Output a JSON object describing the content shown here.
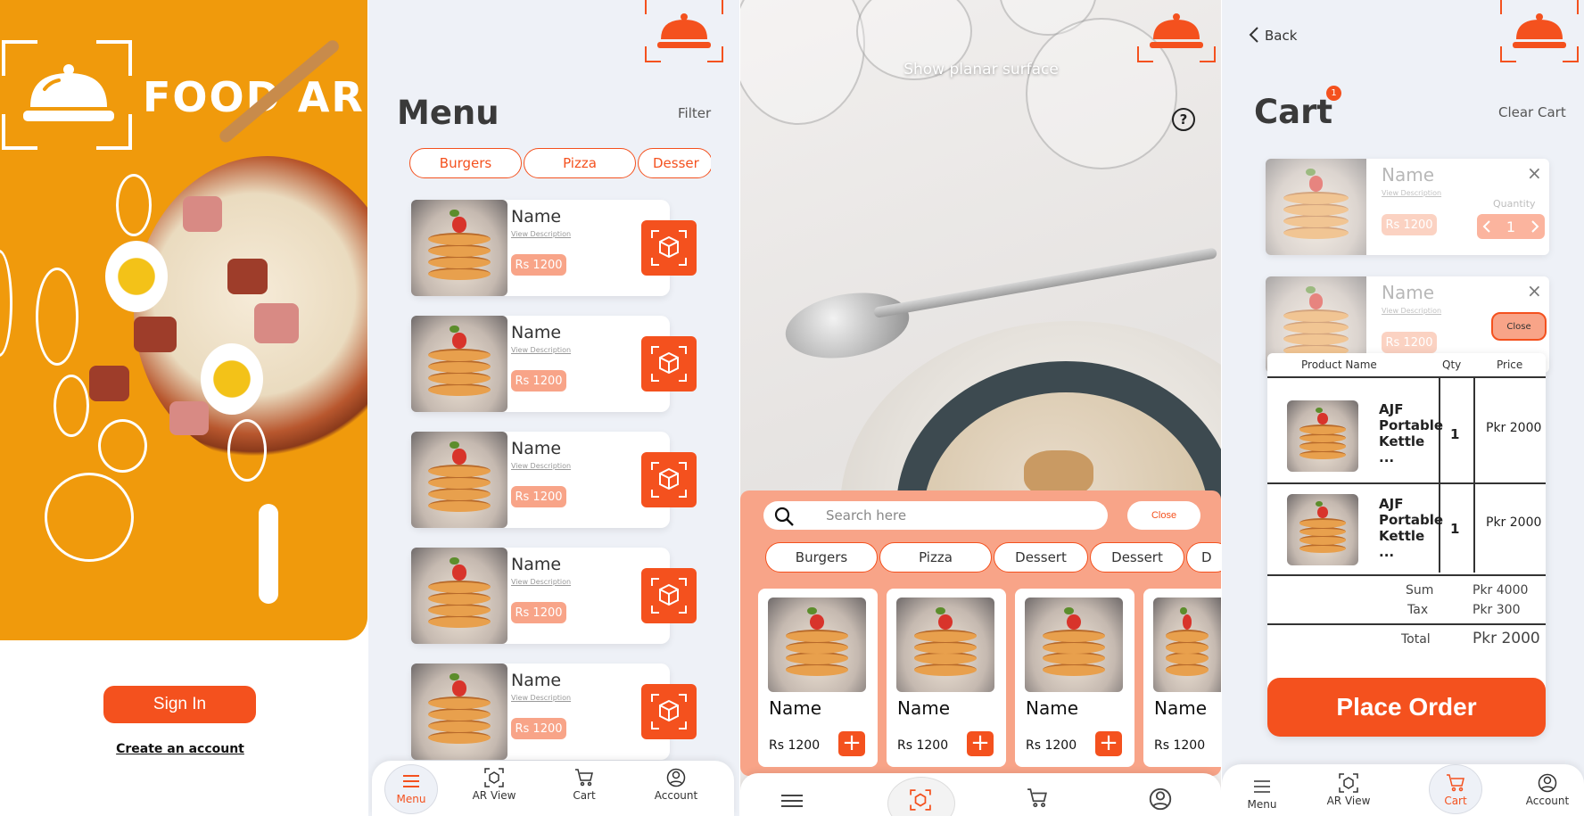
{
  "colors": {
    "brand_orange": "#f09a0c",
    "accent": "#f4511e",
    "accent_light": "#f8a488",
    "bg": "#eef1f7"
  },
  "splash": {
    "brand": "FOOD AR",
    "sign_in": "Sign In",
    "create_account": "Create an account"
  },
  "menu": {
    "title": "Menu",
    "filter": "Filter",
    "categories": [
      "Burgers",
      "Pizza",
      "Desser"
    ],
    "items": [
      {
        "name": "Name",
        "desc": "View Description",
        "price": "Rs 1200"
      },
      {
        "name": "Name",
        "desc": "View Description",
        "price": "Rs 1200"
      },
      {
        "name": "Name",
        "desc": "View Description",
        "price": "Rs 1200"
      },
      {
        "name": "Name",
        "desc": "View Description",
        "price": "Rs 1200"
      },
      {
        "name": "Name",
        "desc": "View Description",
        "price": "Rs 1200"
      }
    ],
    "nav": [
      "Menu",
      "AR View",
      "Cart",
      "Account"
    ]
  },
  "ar": {
    "hint": "Show planar surface",
    "help": "?",
    "search_placeholder": "Search here",
    "close": "Close",
    "categories": [
      "Burgers",
      "Pizza",
      "Dessert",
      "Dessert",
      "D"
    ],
    "items": [
      {
        "name": "Name",
        "price": "Rs 1200",
        "add": "+"
      },
      {
        "name": "Name",
        "price": "Rs 1200",
        "add": "+"
      },
      {
        "name": "Name",
        "price": "Rs 1200",
        "add": "+"
      },
      {
        "name": "Name",
        "price": "Rs 1200"
      }
    ]
  },
  "cart": {
    "back": "Back",
    "title": "Cart",
    "badge": "1",
    "clear": "Clear Cart",
    "items": [
      {
        "name": "Name",
        "desc": "View Description",
        "price": "Rs 1200",
        "qty_label": "Quantity",
        "qty": "1",
        "remove": "×"
      },
      {
        "name": "Name",
        "desc": "View Description",
        "price": "Rs 1200",
        "remove": "×"
      }
    ],
    "close_popup": "Close",
    "order": {
      "headers": {
        "product": "Product Name",
        "qty": "Qty",
        "price": "Price"
      },
      "rows": [
        {
          "name": "AJF Portable Kettle ...",
          "qty": "1",
          "price": "Pkr 2000"
        },
        {
          "name": "AJF Portable Kettle ...",
          "qty": "1",
          "price": "Pkr 2000"
        }
      ],
      "sum_label": "Sum",
      "sum": "Pkr 4000",
      "tax_label": "Tax",
      "tax": "Pkr 300",
      "total_label": "Total",
      "total": "Pkr 2000",
      "place_order": "Place Order"
    },
    "nav": [
      "Menu",
      "AR View",
      "Cart",
      "Account"
    ]
  }
}
